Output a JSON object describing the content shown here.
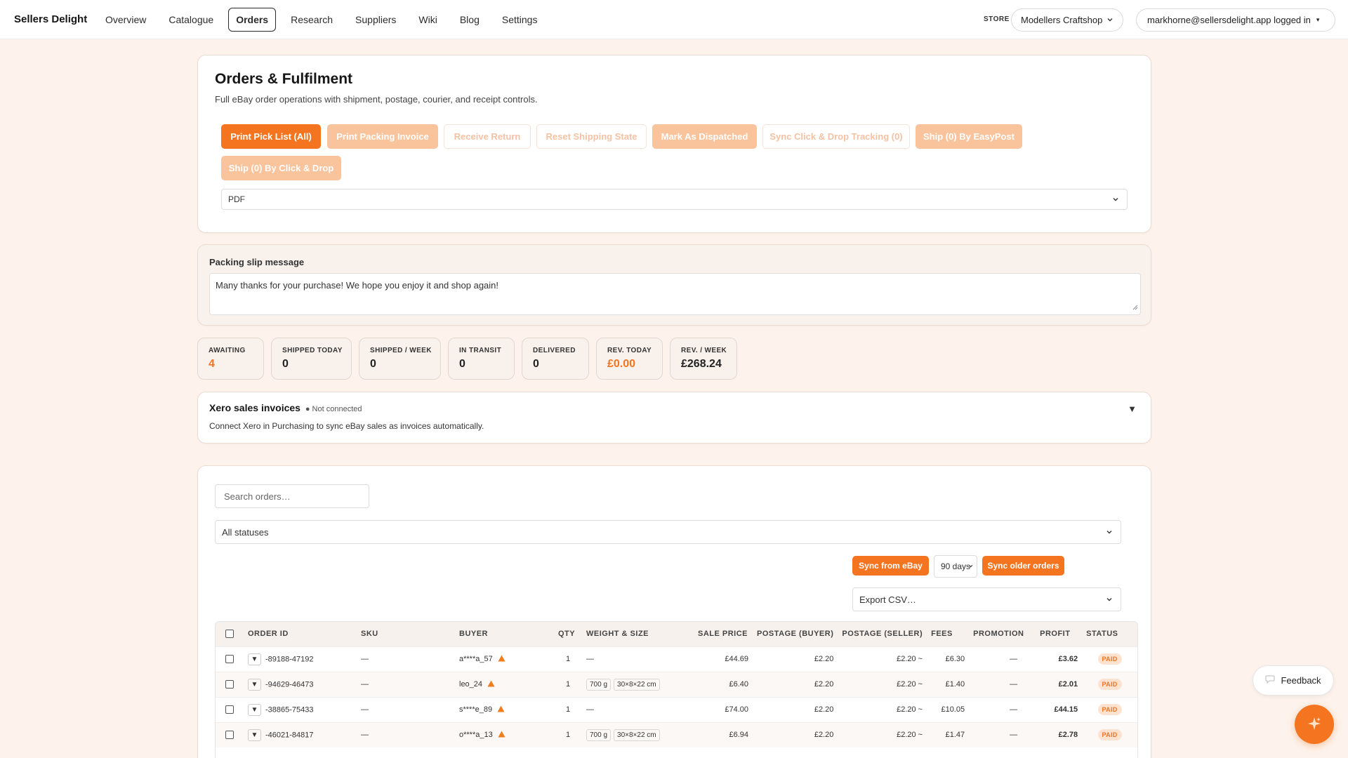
{
  "app": {
    "brand": "Sellers Delight"
  },
  "nav": {
    "items": [
      {
        "label": "Overview"
      },
      {
        "label": "Catalogue"
      },
      {
        "label": "Orders"
      },
      {
        "label": "Research"
      },
      {
        "label": "Suppliers"
      },
      {
        "label": "Wiki"
      },
      {
        "label": "Blog"
      },
      {
        "label": "Settings"
      }
    ],
    "active": "Orders"
  },
  "store": {
    "label": "STORE",
    "selected": "Modellers Craftshop"
  },
  "user": {
    "text": "markhorne@sellersdelight.app logged in"
  },
  "fulfilment": {
    "title": "Orders & Fulfilment",
    "subtitle": "Full eBay order operations with shipment, postage, courier, and receipt controls.",
    "buttons": [
      {
        "label": "Print Pick List (All)",
        "style": "primary"
      },
      {
        "label": "Print Packing Invoice",
        "style": "soft"
      },
      {
        "label": "Receive Return",
        "style": "ghost"
      },
      {
        "label": "Reset Shipping State",
        "style": "ghost"
      },
      {
        "label": "Mark As Dispatched",
        "style": "soft"
      },
      {
        "label": "Sync Click & Drop Tracking (0)",
        "style": "ghost"
      },
      {
        "label": "Ship (0) By EasyPost",
        "style": "soft"
      },
      {
        "label": "Ship (0) By Click & Drop",
        "style": "soft"
      }
    ],
    "format_select": "PDF"
  },
  "packing_slip": {
    "label": "Packing slip message",
    "message": "Many thanks for your purchase! We hope you enjoy it and shop again!"
  },
  "stats": [
    {
      "label": "AWAITING",
      "value": "4",
      "accent": true
    },
    {
      "label": "SHIPPED TODAY",
      "value": "0",
      "accent": false
    },
    {
      "label": "SHIPPED / WEEK",
      "value": "0",
      "accent": false
    },
    {
      "label": "IN TRANSIT",
      "value": "0",
      "accent": false
    },
    {
      "label": "DELIVERED",
      "value": "0",
      "accent": false
    },
    {
      "label": "REV. TODAY",
      "value": "£0.00",
      "accent": true
    },
    {
      "label": "REV. / WEEK",
      "value": "£268.24",
      "accent": false
    }
  ],
  "xero": {
    "title": "Xero sales invoices",
    "status": "● Not connected",
    "description": "Connect Xero in Purchasing to sync eBay sales as invoices automatically.",
    "toggle": "▼"
  },
  "orders": {
    "search_placeholder": "Search orders…",
    "status_filter": "All statuses",
    "sync_button": "Sync from eBay",
    "days_select": "90 days",
    "sync_older_button": "Sync older orders",
    "export_select": "Export CSV…",
    "columns": [
      "ORDER ID",
      "SKU",
      "BUYER",
      "QTY",
      "WEIGHT & SIZE",
      "SALE PRICE",
      "POSTAGE (BUYER)",
      "POSTAGE (SELLER)",
      "FEES",
      "PROMOTION",
      "PROFIT",
      "STATUS"
    ],
    "rows": [
      {
        "order_id": "-89188-47192",
        "sku": "—",
        "buyer": "a****a_57",
        "qty": "1",
        "weight": "",
        "size": "",
        "weight_empty": "—",
        "sale_price": "£44.69",
        "postage_buyer": "£2.20",
        "postage_seller": "£2.20 ~",
        "fees": "£6.30",
        "promotion": "—",
        "profit": "£3.62",
        "status": "PAID"
      },
      {
        "order_id": "-94629-46473",
        "sku": "—",
        "buyer": "leo_24",
        "qty": "1",
        "weight": "700 g",
        "size": "30×8×22 cm",
        "weight_empty": "",
        "sale_price": "£6.40",
        "postage_buyer": "£2.20",
        "postage_seller": "£2.20 ~",
        "fees": "£1.40",
        "promotion": "—",
        "profit": "£2.01",
        "status": "PAID"
      },
      {
        "order_id": "-38865-75433",
        "sku": "—",
        "buyer": "s****e_89",
        "qty": "1",
        "weight": "",
        "size": "",
        "weight_empty": "—",
        "sale_price": "£74.00",
        "postage_buyer": "£2.20",
        "postage_seller": "£2.20 ~",
        "fees": "£10.05",
        "promotion": "—",
        "profit": "£44.15",
        "status": "PAID"
      },
      {
        "order_id": "-46021-84817",
        "sku": "—",
        "buyer": "o****a_13",
        "qty": "1",
        "weight": "700 g",
        "size": "30×8×22 cm",
        "weight_empty": "",
        "sale_price": "£6.94",
        "postage_buyer": "£2.20",
        "postage_seller": "£2.20 ~",
        "fees": "£1.47",
        "promotion": "—",
        "profit": "£2.78",
        "status": "PAID"
      }
    ]
  },
  "feedback": {
    "label": "Feedback"
  },
  "colors": {
    "accent": "#f4741f",
    "accent_soft": "#f9c39c",
    "background": "#fdf3ec",
    "profit": "#2e9a3a"
  },
  "icons": {
    "feedback": "speech-bubble-icon",
    "fab": "sparkle-icon",
    "warning": "warning-triangle-icon"
  }
}
